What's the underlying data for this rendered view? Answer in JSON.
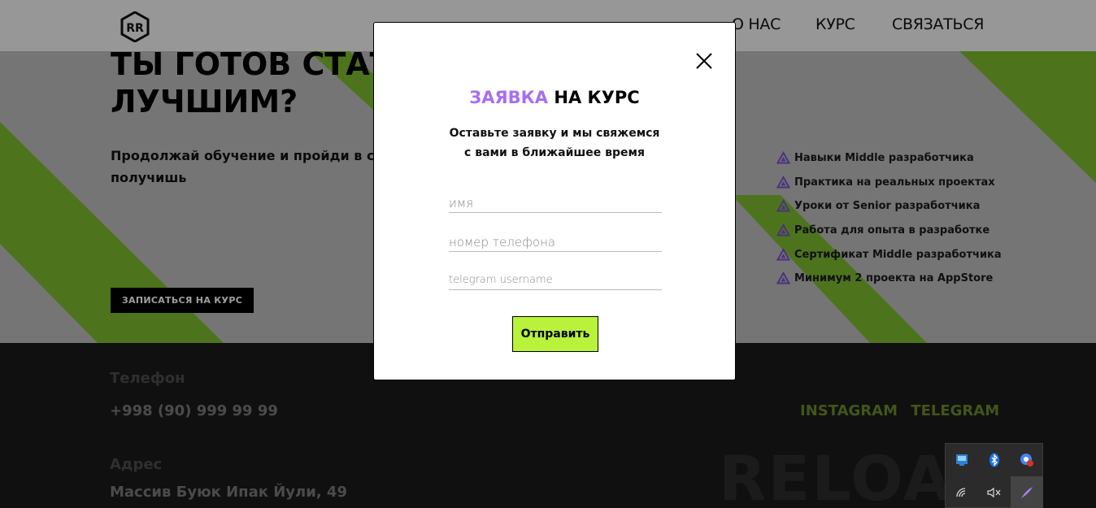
{
  "colors": {
    "accent_purple": "#a86ef0",
    "accent_green": "#b8f23a",
    "hero_stripe_green": "#7dbb2f",
    "footer_bg": "#1a1a1a",
    "social_green": "#6b8a2a"
  },
  "nav": {
    "logo_icon": "rr-logo-icon",
    "items": [
      "О НАС",
      "КУРС",
      "СВЯЗАТЬСЯ"
    ]
  },
  "hero": {
    "title_line1": "ТЫ ГОТОВ СТАТЬ",
    "title_line2": "ЛУЧШИМ?",
    "subtitle_line1": "Продолжай обучение и пройди в сле",
    "subtitle_line2": "получишь",
    "cta_label": "ЗАПИСАТЬСЯ НА КУРС",
    "feature_icon": "triangle-icon",
    "features": [
      "Навыки Middle разработчика",
      "Практика на реальных проектах",
      "Уроки от Senior разработчика",
      "Работа для опыта в разработке",
      "Сертификат Middle разработчика",
      "Минимум 2 проекта на AppStore"
    ]
  },
  "footer": {
    "phone_label": "Телефон",
    "phone_value": "+998 (90) 999 99 99",
    "address_label": "Адрес",
    "address_value": "Массив Буюк Ипак Йули, 49",
    "social_instagram": "INSTAGRAM",
    "social_telegram": "TELEGRAM",
    "brand_big": "RELOAD"
  },
  "modal": {
    "title_accent": "ЗАЯВКА",
    "title_rest": " НА КУРС",
    "desc_line1": "Оставьте заявку и мы свяжемся",
    "desc_line2": "с вами в ближайшее время",
    "fields": {
      "name_placeholder": "имя",
      "phone_placeholder": "номер телефона",
      "telegram_placeholder": "telegram username"
    },
    "submit_label": "Отправить",
    "close_icon": "close-icon"
  },
  "tray": {
    "icons": [
      "network-settings-icon",
      "bluetooth-icon",
      "chrome-notification-icon",
      "wifi-icon",
      "volume-muted-icon",
      "pen-icon"
    ]
  }
}
